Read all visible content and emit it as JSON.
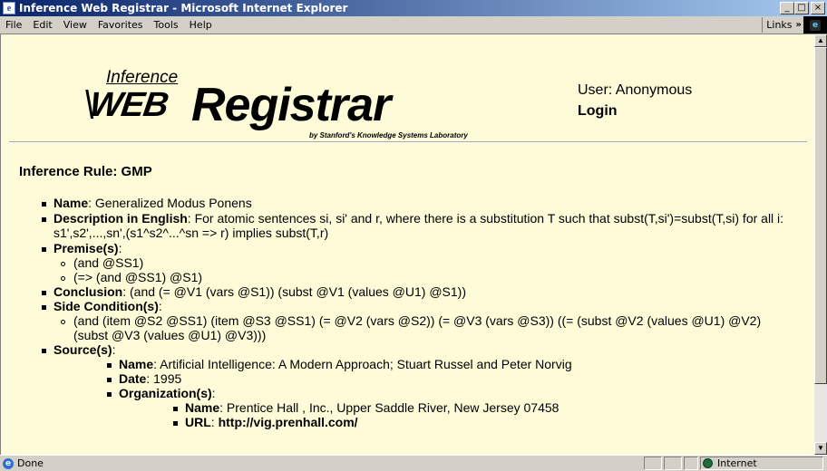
{
  "window": {
    "title": "Inference Web Registrar - Microsoft Internet Explorer",
    "minimize": "_",
    "maximize": "□",
    "close": "×"
  },
  "menu": [
    "File",
    "Edit",
    "View",
    "Favorites",
    "Tools",
    "Help"
  ],
  "links_label": "Links",
  "logo": {
    "inference": "Inference",
    "web": "WEB",
    "registrar": "Registrar",
    "byline": "by Stanford's Knowledge Systems Laboratory"
  },
  "user": {
    "label": "User: Anonymous",
    "login": "Login"
  },
  "rule": {
    "heading": "Inference Rule: GMP",
    "name_label": "Name",
    "name_value": ": Generalized Modus Ponens",
    "desc_label": "Description in English",
    "desc_value_1": ": For atomic sentences si, si' and r, where there is a substitution T such that subst(T,si')=subst(T,si) for all i:",
    "desc_value_2": "s1',s2',...,sn',(s1^s2^...^sn => r) implies subst(T,r)",
    "premise_label": "Premise(s)",
    "premises": [
      "(and @SS1)",
      "(=> (and @SS1) @S1)"
    ],
    "conclusion_label": "Conclusion",
    "conclusion_value": ": (and (= @V1 (vars @S1)) (subst @V1 (values @U1) @S1))",
    "side_label": "Side Condition(s)",
    "side_1": "(and (item @S2 @SS1) (item @S3 @SS1) (= @V2 (vars @S2)) (= @V3 (vars @S3)) ((= (subst @V2 (values @U1) @V2)",
    "side_2": "(subst @V3 (values @U1) @V3)))",
    "source_label": "Source(s)",
    "src_name_label": "Name",
    "src_name_value": ": Artificial Intelligence: A Modern Approach; Stuart Russel and Peter Norvig",
    "src_date_label": "Date",
    "src_date_value": ": 1995",
    "src_org_label": "Organization(s)",
    "org_name_label": "Name",
    "org_name_value": ": Prentice Hall , Inc., Upper Saddle River, New Jersey 07458",
    "org_url_label": "URL",
    "org_url_sep": ": ",
    "org_url_value": "http://vig.prenhall.com/"
  },
  "status": {
    "text": "Done",
    "zone": "Internet"
  }
}
